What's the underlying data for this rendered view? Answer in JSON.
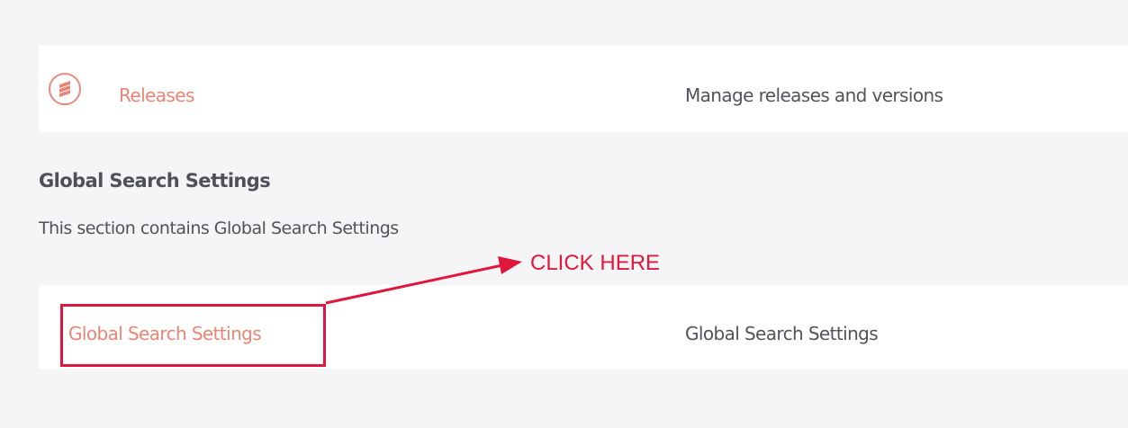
{
  "releases_row": {
    "icon": "stacked-layers-icon",
    "link_label": "Releases",
    "description": "Manage releases and versions"
  },
  "section": {
    "title": "Global Search Settings",
    "description": "This section contains Global Search Settings"
  },
  "global_row": {
    "link_label": "Global Search Settings",
    "description": "Global Search Settings"
  },
  "annotation": {
    "label": "CLICK HERE",
    "color": "#e0173c"
  },
  "colors": {
    "link": "#ea8575",
    "background": "#f5f5f7",
    "row_background": "#ffffff",
    "text": "#4f5259"
  }
}
